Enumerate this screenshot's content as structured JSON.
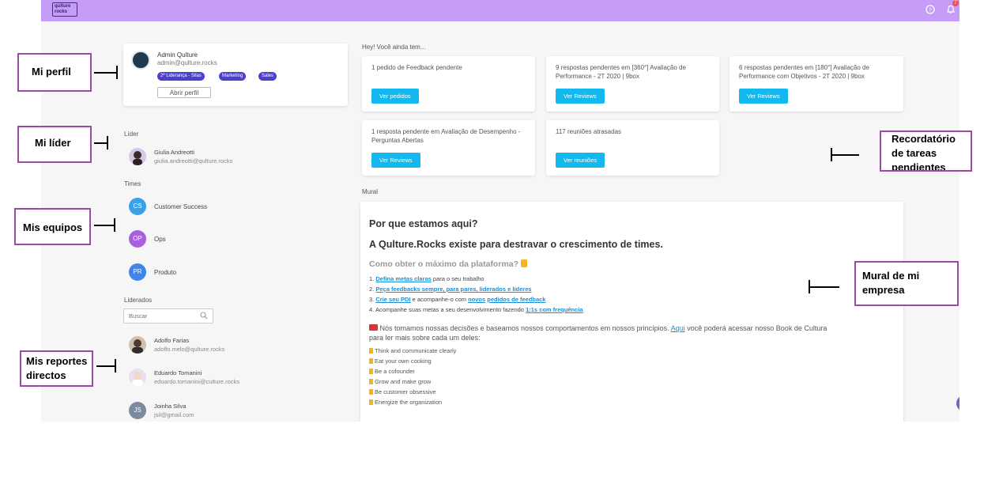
{
  "topbar": {
    "logo_line1": "qulture",
    "logo_line2": "rocks",
    "help_icon": "help-circle-icon",
    "bell_icon": "bell-icon",
    "notification_count": "7"
  },
  "profile": {
    "name": "Admin Qulture",
    "email": "admin@qulture.rocks",
    "tags": [
      "2ª Liderança - Silas",
      "Marketing",
      "Sales"
    ],
    "open_profile_label": "Abrir perfil"
  },
  "leader": {
    "title": "Líder",
    "name": "Giulia Andreotti",
    "email": "giulia.andreotti@qulture.rocks"
  },
  "teams": {
    "title": "Times",
    "items": [
      {
        "initials": "CS",
        "name": "Customer Success",
        "color": "#3aa0ea"
      },
      {
        "initials": "OP",
        "name": "Ops",
        "color": "#a85fe0"
      },
      {
        "initials": "PR",
        "name": "Produto",
        "color": "#3f86e8"
      }
    ]
  },
  "led": {
    "title": "Liderados",
    "search_placeholder": "Buscar",
    "items": [
      {
        "name": "Adolfo Farias",
        "email": "adolfo.melo@qulture.rocks"
      },
      {
        "name": "Eduardo Tomanini",
        "email": "eduardo.tomanini@culture.rocks"
      },
      {
        "initials": "JS",
        "name": "Joinha Silva",
        "email": "jsil@gmail.com"
      }
    ]
  },
  "pending": {
    "title": "Hey! Você ainda tem...",
    "cards": [
      {
        "text": "1 pedido de Feedback pendente",
        "button": "Ver pedidos"
      },
      {
        "text": "9 respostas pendentes em [360°] Avaliação de Performance - 2T 2020 | 9box",
        "button": "Ver Reviews"
      },
      {
        "text": "6 respostas pendentes em [180°] Avaliação de Performance com Objetivos - 2T 2020 | 9box",
        "button": "Ver Reviews"
      },
      {
        "text": "1 resposta pendente em Avaliação de Desempenho - Perguntas Abertas",
        "button": "Ver Reviews"
      },
      {
        "text": "117 reuniões atrasadas",
        "button": "Ver reuniões"
      }
    ]
  },
  "mural": {
    "title": "Mural",
    "heading1": "Por que estamos aqui?",
    "heading2": "A Qulture.Rocks existe para destravar o crescimento de times.",
    "heading3": "Como obter o máximo da plataforma?",
    "steps": [
      {
        "num": "1.",
        "link": "Defina metas claras",
        "rest": " para o seu trabalho"
      },
      {
        "num": "2.",
        "link": "Peça feedbacks sempre, para pares, liderados e líderes",
        "rest": ""
      },
      {
        "num": "3.",
        "link": "Crie seu PDI",
        "rest": " e acompanhe-o com ",
        "link2": "novos",
        "rest2": " ",
        "link3": "pedidos de feedback"
      },
      {
        "num": "4.",
        "link": "",
        "rest": "Acompanhe suas metas a seu desenvolvimento fazendo ",
        "link2": "1:1s com frequência"
      }
    ],
    "para_before": "Nós tomamos nossas decisões e baseamos nossos comportamentos em nossos princípios.",
    "para_link": "Aqui",
    "para_after": "você poderá acessar nosso Book de Cultura",
    "para_line2": "para ler mais sobre cada um deles:",
    "values": [
      "Think and communicate clearly",
      "Eat your own cooking",
      "Be a cofounder",
      "Grow and make grow",
      "Be customer obsessive",
      "Energize the organization"
    ]
  },
  "annotations": {
    "profile": "Mi perfil",
    "leader": "Mi líder",
    "teams": "Mis equipos",
    "reports_line1": "Mis reportes",
    "reports_line2": "directos",
    "tasks_line1": "Recordatório",
    "tasks_line2": "de tareas",
    "tasks_line3": "pendientes",
    "mural_line1": "Mural de mi",
    "mural_line2": "empresa"
  }
}
